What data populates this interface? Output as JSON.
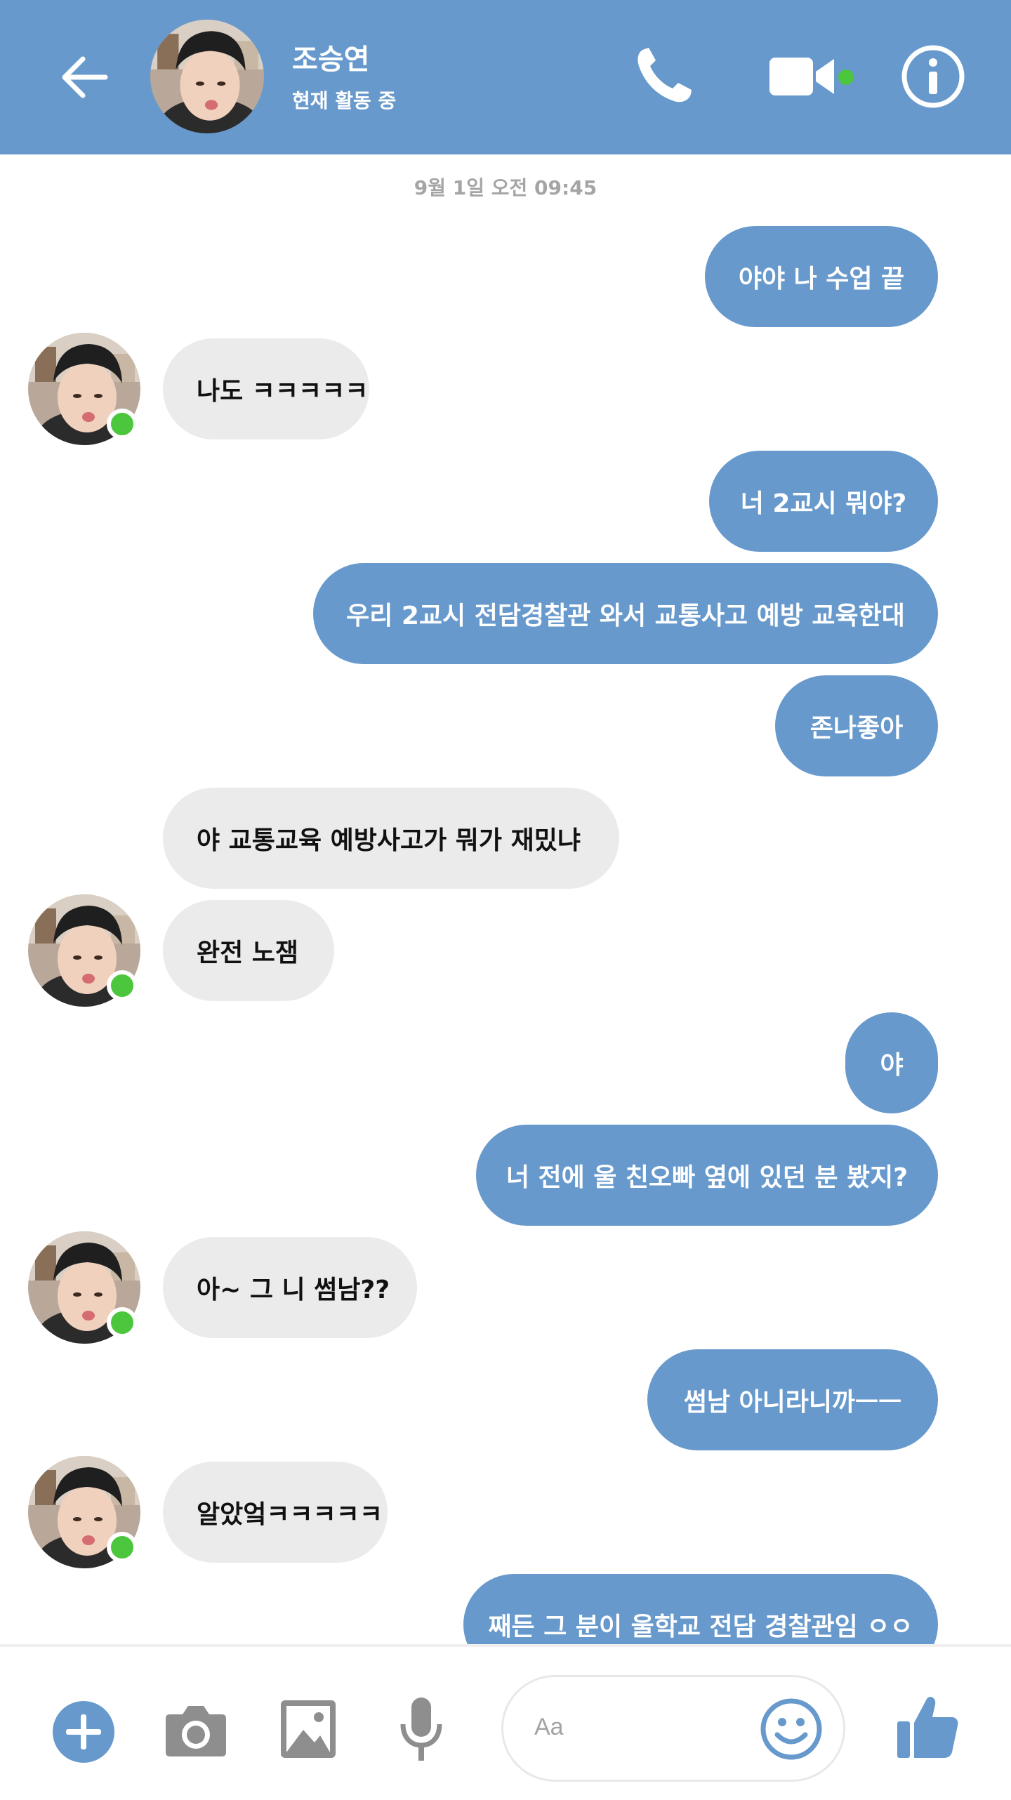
{
  "header": {
    "contact_name": "조승연",
    "status": "현재 활동 중",
    "accent": "#6799cc"
  },
  "timestamp": "9월 1일 오전 09:45",
  "messages": [
    {
      "dir": "out",
      "text": "야야 나 수업 끝"
    },
    {
      "dir": "in",
      "text": "나도 ㅋㅋㅋㅋㅋ",
      "avatar": true
    },
    {
      "dir": "out",
      "text": "너 2교시 뭐야?"
    },
    {
      "dir": "out",
      "text": "우리 2교시 전담경찰관 와서 교통사고 예방 교육한대"
    },
    {
      "dir": "out",
      "text": "존나좋아"
    },
    {
      "dir": "in",
      "text": "야 교통교육 예방사고가 뭐가 재밌냐",
      "avatar": false
    },
    {
      "dir": "in",
      "text": "완전 노잼",
      "avatar": true
    },
    {
      "dir": "out",
      "text": "야"
    },
    {
      "dir": "out",
      "text": "너 전에 울 친오빠 옆에 있던 분 봤지?"
    },
    {
      "dir": "in",
      "text": "아~ 그 니 썸남??",
      "avatar": true
    },
    {
      "dir": "out",
      "text": "썸남 아니라니까ㅡㅡ"
    },
    {
      "dir": "in",
      "text": "알았엌ㅋㅋㅋㅋㅋ",
      "avatar": true
    },
    {
      "dir": "out",
      "text": "째든 그 분이 울학교 전담 경찰관임 ㅇㅇ"
    }
  ],
  "composer": {
    "placeholder": "Aa",
    "icons": [
      "plus-icon",
      "camera-icon",
      "image-icon",
      "microphone-icon",
      "emoji-icon",
      "thumbs-up-icon"
    ]
  },
  "colors": {
    "outgoing_bubble": "#6799cc",
    "incoming_bubble": "#ebebeb",
    "online_dot": "#4cc63c"
  }
}
